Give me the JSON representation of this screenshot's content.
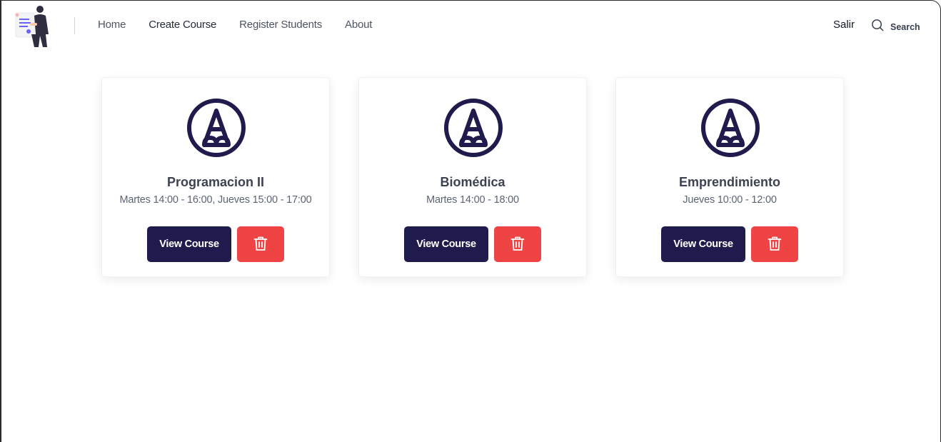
{
  "nav": {
    "items": [
      {
        "label": "Home"
      },
      {
        "label": "Create Course"
      },
      {
        "label": "Register Students"
      },
      {
        "label": "About"
      }
    ],
    "logout_label": "Salir",
    "search_label": "Search"
  },
  "courses": [
    {
      "title": "Programacion II",
      "schedule": "Martes 14:00 - 16:00, Jueves 15:00 - 17:00",
      "view_label": "View Course"
    },
    {
      "title": "Biomédica",
      "schedule": "Martes 14:00 - 18:00",
      "view_label": "View Course"
    },
    {
      "title": "Emprendimiento",
      "schedule": "Jueves 10:00 - 12:00",
      "view_label": "View Course"
    }
  ],
  "colors": {
    "primary": "#1f1b4d",
    "danger": "#ef4444",
    "icon": "#1f1b4d"
  },
  "icons": {
    "course": "pencil-circle-icon",
    "delete": "trash-icon",
    "search": "search-icon"
  }
}
